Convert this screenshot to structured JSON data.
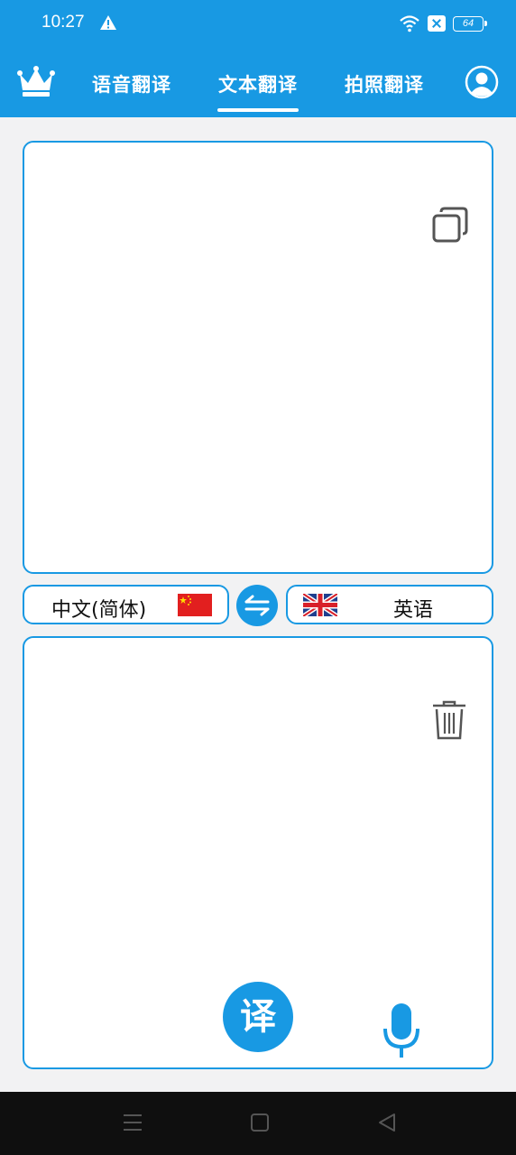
{
  "status_bar": {
    "time": "10:27",
    "battery": "64"
  },
  "header": {
    "tabs": [
      {
        "label": "语音翻译",
        "active": false
      },
      {
        "label": "文本翻译",
        "active": true
      },
      {
        "label": "拍照翻译",
        "active": false
      }
    ]
  },
  "language_bar": {
    "source_language": "中文(简体)",
    "target_language": "英语"
  },
  "actions": {
    "translate_label": "译"
  },
  "colors": {
    "accent": "#1899e3",
    "background": "#f2f2f3",
    "panel": "#ffffff"
  }
}
